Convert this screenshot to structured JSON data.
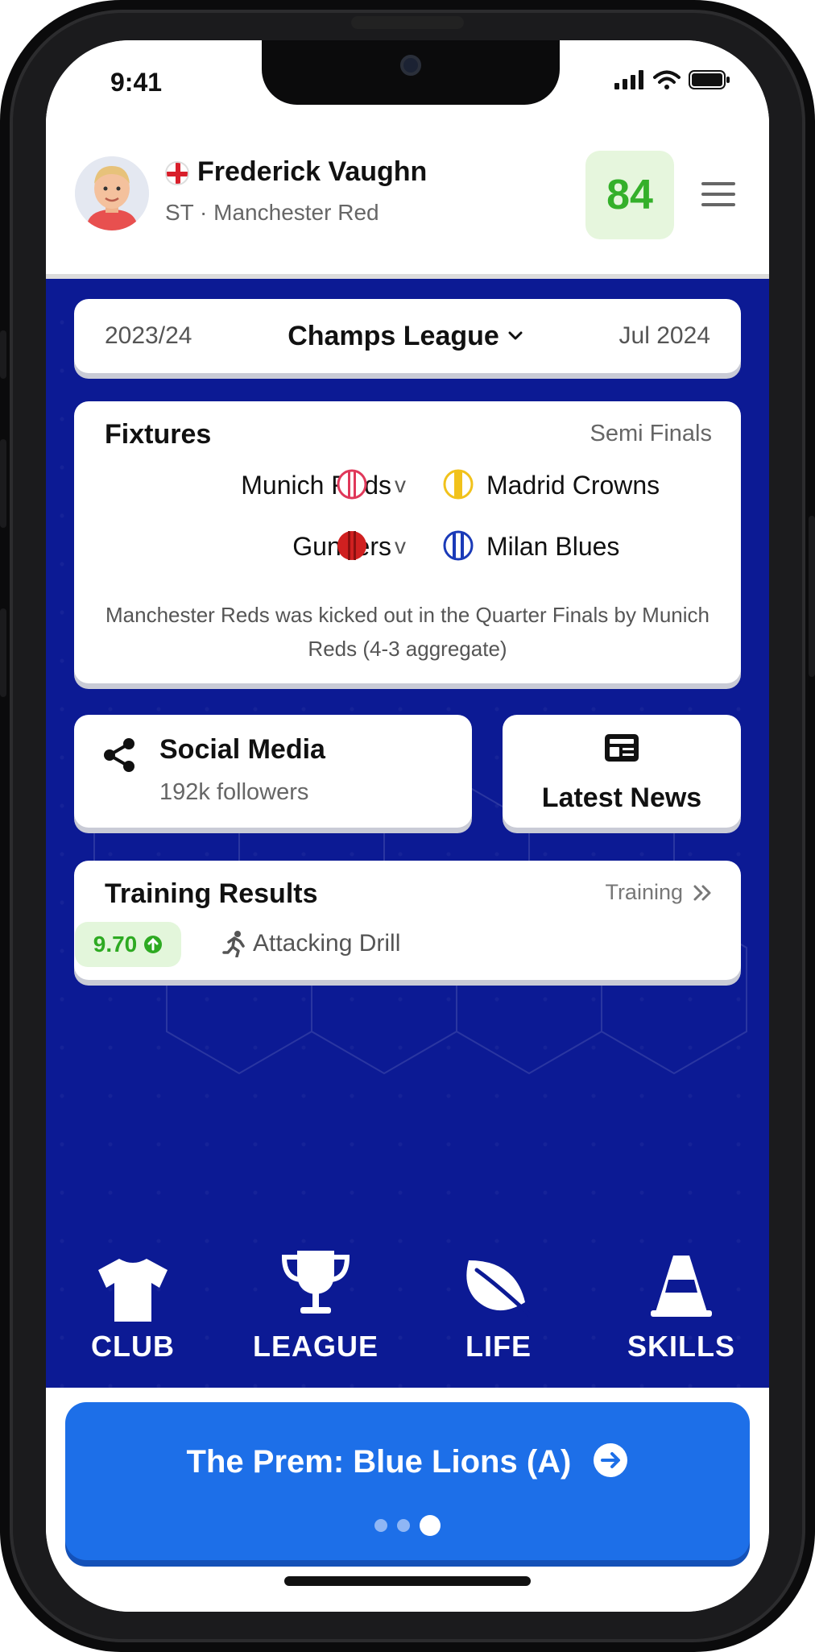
{
  "status_bar": {
    "time": "9:41"
  },
  "header": {
    "player_name": "Frederick Vaughn",
    "position_club": "ST · Manchester Red",
    "rating": "84"
  },
  "season_bar": {
    "season": "2023/24",
    "competition": "Champs League",
    "date": "Jul 2024"
  },
  "fixtures": {
    "title": "Fixtures",
    "stage": "Semi Finals",
    "matches": [
      {
        "home": "Munich Reds",
        "vs": "v",
        "away": "Madrid Crowns"
      },
      {
        "home": "Gunners",
        "vs": "v",
        "away": "Milan Blues"
      }
    ],
    "note": "Manchester Reds was kicked out in the Quarter Finals by Munich Reds (4-3 aggregate)"
  },
  "social": {
    "title": "Social Media",
    "followers": "192k followers"
  },
  "news": {
    "title": "Latest News"
  },
  "training": {
    "title": "Training Results",
    "link": "Training",
    "score": "9.70",
    "drill": "Attacking Drill"
  },
  "nav": [
    {
      "label": "CLUB",
      "icon": "shirt-icon"
    },
    {
      "label": "LEAGUE",
      "icon": "trophy-icon"
    },
    {
      "label": "LIFE",
      "icon": "leaf-icon"
    },
    {
      "label": "SKILLS",
      "icon": "cone-icon"
    }
  ],
  "promo": {
    "text": "The Prem: Blue Lions (A)",
    "active_dot": 3,
    "dot_count": 3
  },
  "colors": {
    "background_blue": "#0c1a94",
    "promo_blue": "#1d6fe8",
    "rating_green": "#34b02a"
  }
}
